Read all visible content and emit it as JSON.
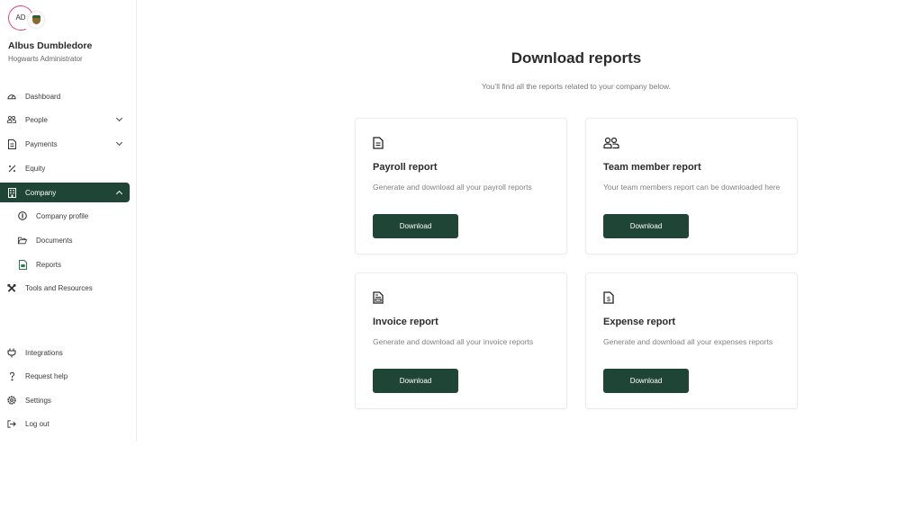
{
  "user": {
    "initials": "AD",
    "name": "Albus Dumbledore",
    "role": "Hogwarts Administrator"
  },
  "sidebar": {
    "items": [
      {
        "label": "Dashboard",
        "icon": "dashboard-icon"
      },
      {
        "label": "People",
        "icon": "people-icon",
        "expandable": true
      },
      {
        "label": "Payments",
        "icon": "payments-icon",
        "expandable": true
      },
      {
        "label": "Equity",
        "icon": "percent-icon"
      },
      {
        "label": "Company",
        "icon": "building-icon",
        "expandable": true,
        "expanded": true,
        "active": true
      },
      {
        "label": "Company profile",
        "icon": "info-icon",
        "sub": true
      },
      {
        "label": "Documents",
        "icon": "folder-icon",
        "sub": true
      },
      {
        "label": "Reports",
        "icon": "report-icon",
        "sub": true,
        "active": true
      },
      {
        "label": "Tools and Resources",
        "icon": "tools-icon"
      }
    ],
    "bottom_items": [
      {
        "label": "Integrations",
        "icon": "plug-icon"
      },
      {
        "label": "Request help",
        "icon": "help-icon"
      },
      {
        "label": "Settings",
        "icon": "gear-icon"
      },
      {
        "label": "Log out",
        "icon": "logout-icon"
      }
    ]
  },
  "main": {
    "title": "Download reports",
    "subtitle": "You’ll find all the reports related to your company below.",
    "cards": [
      {
        "title": "Payroll report",
        "description": "Generate and download all your payroll reports",
        "button": "Download",
        "icon": "document-icon"
      },
      {
        "title": "Team member report",
        "description": "Your team members report can be downloaded here",
        "button": "Download",
        "icon": "team-icon"
      },
      {
        "title": "Invoice report",
        "description": "Generate and download all your invoice reports",
        "button": "Download",
        "icon": "invoice-icon"
      },
      {
        "title": "Expense report",
        "description": "Generate and download all your expenses reports",
        "button": "Download",
        "icon": "expense-icon"
      }
    ]
  },
  "colors": {
    "brand": "#1e4535",
    "avatar_ring": "#e0457b",
    "active_icon": "#2f7a4f"
  }
}
